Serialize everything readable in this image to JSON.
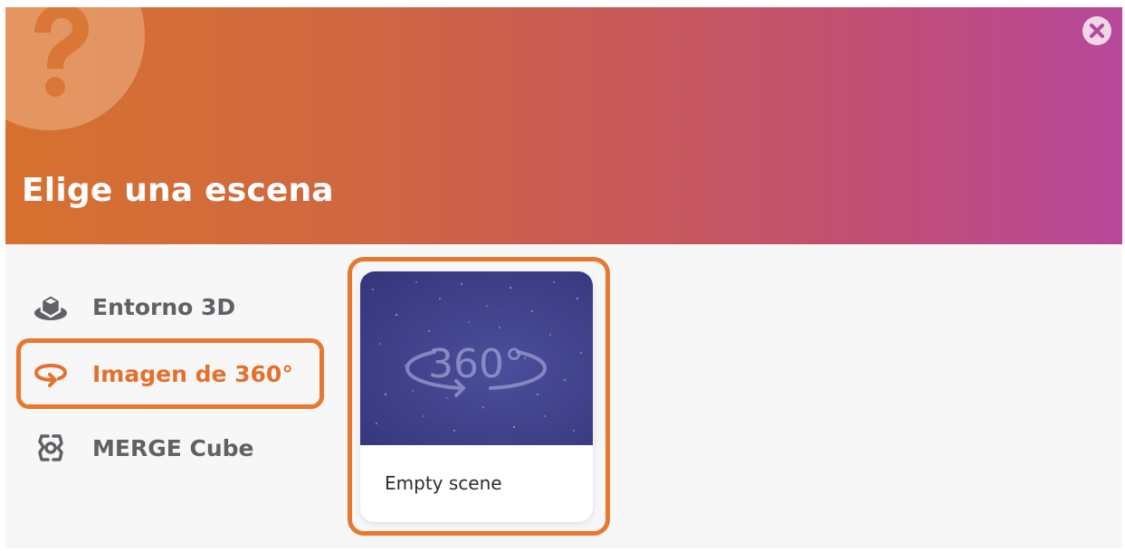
{
  "dialog": {
    "title": "Elige una escena",
    "header_gradient": [
      "#d7712f",
      "#b7489a"
    ],
    "accent": "#e8782f",
    "icons": {
      "help": "question-mark-icon",
      "close": "close-icon"
    }
  },
  "sidebar": {
    "items": [
      {
        "label": "Entorno 3D",
        "icon": "cube-3d-icon",
        "selected": false
      },
      {
        "label": "Imagen de 360°",
        "icon": "rotate-360-icon",
        "selected": true
      },
      {
        "label": "MERGE Cube",
        "icon": "merge-cube-icon",
        "selected": false
      }
    ]
  },
  "scenes": [
    {
      "label": "Empty scene",
      "thumbnail_text": "360°",
      "selected": true
    }
  ]
}
